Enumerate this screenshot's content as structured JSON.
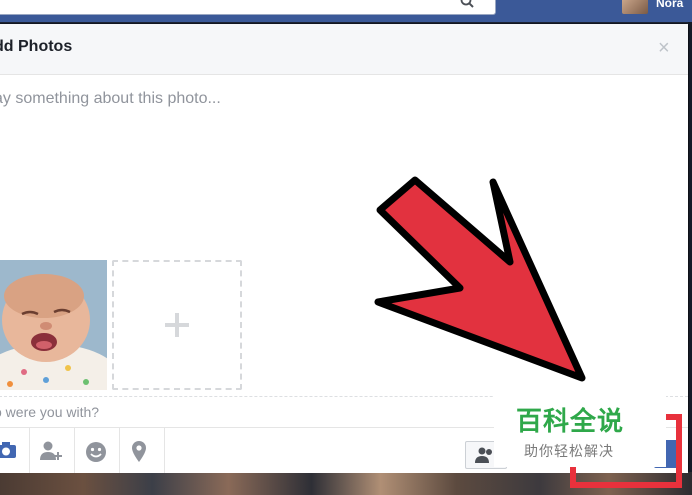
{
  "topbar": {
    "user_name": "Nora",
    "search_icon": "search-icon"
  },
  "dialog": {
    "title": "dd Photos",
    "close_label": "×",
    "composer_placeholder": "ay something about this photo...",
    "with_placeholder": "o were you with?",
    "toolbar_icons": [
      "camera-icon",
      "tag-friends-icon",
      "feeling-icon",
      "location-icon",
      "audience-icon"
    ],
    "add_photo_label": "+"
  },
  "watermark": {
    "title": "百科全说",
    "subtitle": "助你轻松解决"
  },
  "colors": {
    "facebook_blue": "#3b5998",
    "post_button_blue": "#4267b2",
    "annotation_red": "#e8313c",
    "watermark_green": "#2fa84a"
  }
}
